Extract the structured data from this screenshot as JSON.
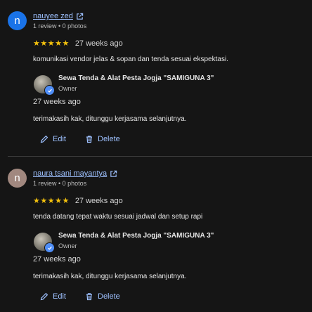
{
  "colors": {
    "background": "#151515",
    "link": "#9ec1ff",
    "star": "#f4c20d",
    "avatar_blue": "#1a73e8",
    "avatar_brown": "#a1887f",
    "verified_badge": "#4f8ef7"
  },
  "reviews": [
    {
      "avatar_letter": "n",
      "author": "nauyee zed",
      "meta": "1 review • 0 photos",
      "stars": "★★★★★",
      "rating": 5,
      "date": "27 weeks ago",
      "text": "komunikasi vendor jelas & sopan dan tenda sesuai ekspektasi.",
      "owner_reply": {
        "name": "Sewa Tenda & Alat Pesta Jogja \"SAMIGUNA 3\"",
        "role": "Owner",
        "date": "27 weeks ago",
        "text": "terimakasih kak, ditunggu kerjasama selanjutnya."
      },
      "actions": {
        "edit": "Edit",
        "delete": "Delete"
      }
    },
    {
      "avatar_letter": "n",
      "author": "naura tsani mayantya",
      "meta": "1 review • 0 photos",
      "stars": "★★★★★",
      "rating": 5,
      "date": "27 weeks ago",
      "text": "tenda datang tepat waktu sesuai jadwal dan setup rapi",
      "owner_reply": {
        "name": "Sewa Tenda & Alat Pesta Jogja \"SAMIGUNA 3\"",
        "role": "Owner",
        "date": "27 weeks ago",
        "text": "terimakasih kak, ditunggu kerjasama selanjutnya."
      },
      "actions": {
        "edit": "Edit",
        "delete": "Delete"
      }
    }
  ],
  "icons": {
    "external_link": "open-in-new-icon",
    "edit": "pencil-icon",
    "delete": "trash-icon",
    "verified": "verified-check-icon"
  }
}
